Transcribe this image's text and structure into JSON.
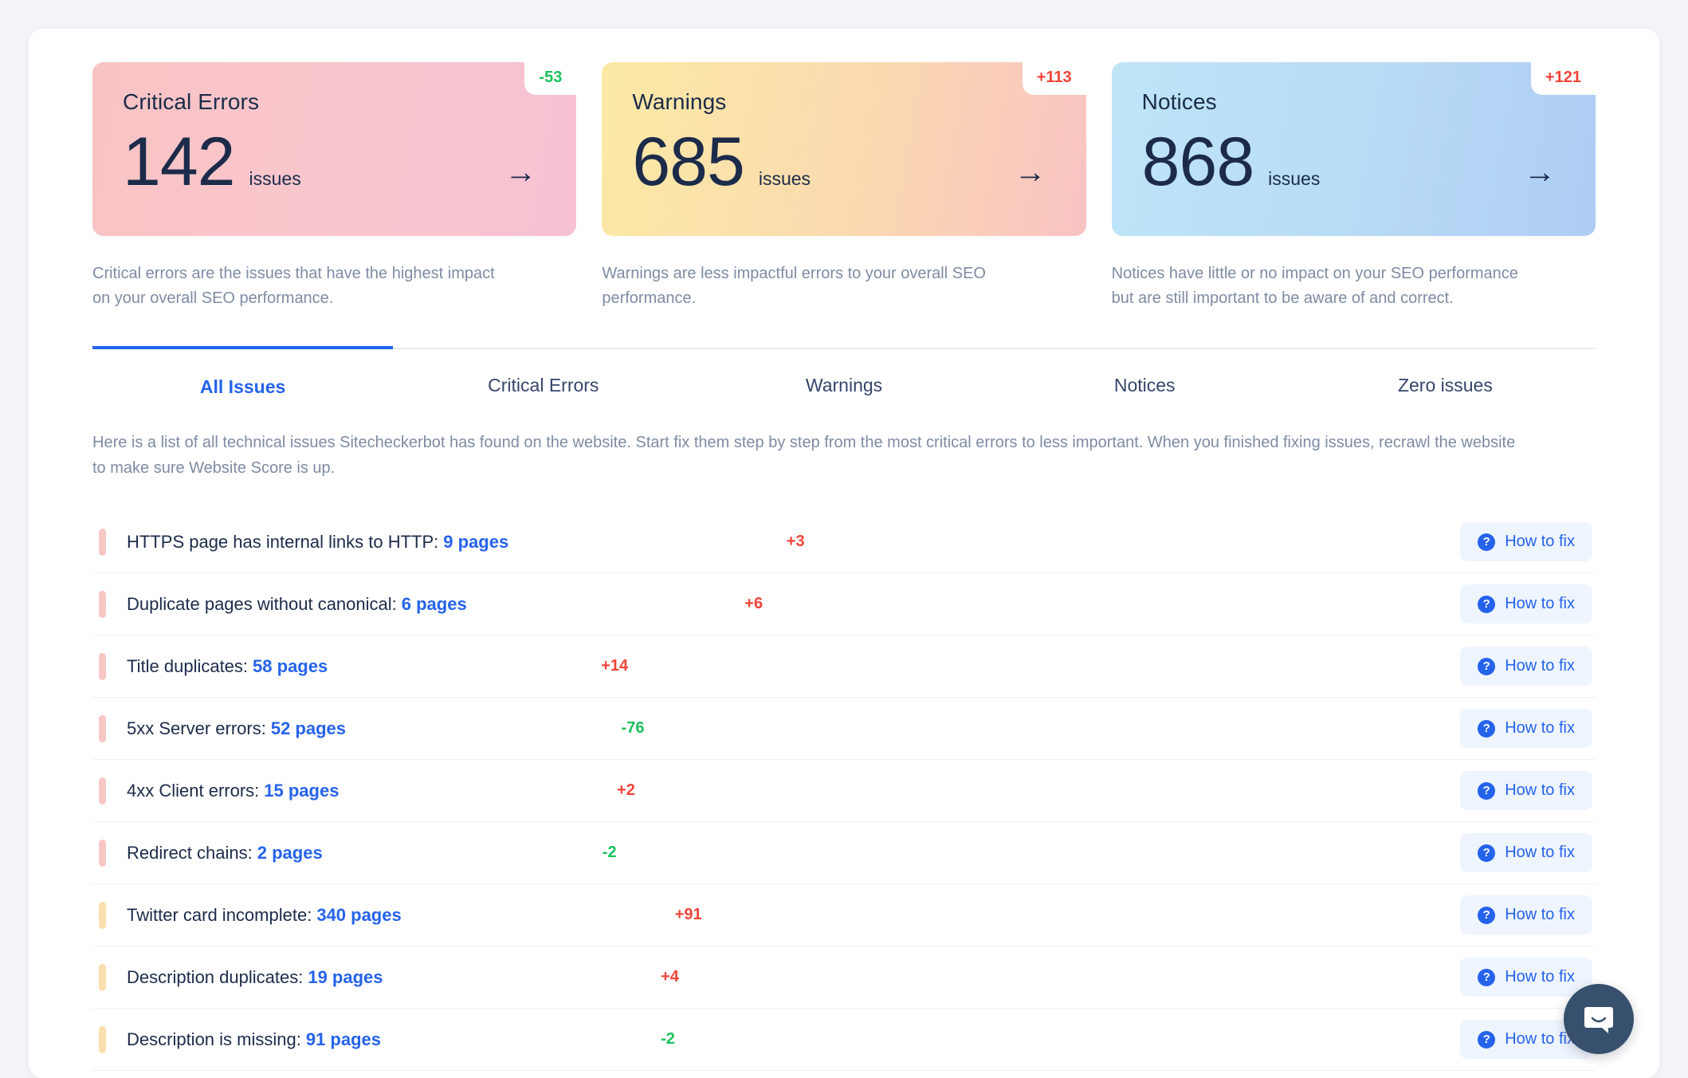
{
  "cards": [
    {
      "title": "Critical Errors",
      "value": "142",
      "unit": "issues",
      "badge": "-53",
      "badge_dir": "down",
      "arrow": "→",
      "description": "Critical errors are the issues that have the highest impact on your overall SEO performance.",
      "accent": "#f9c6c6"
    },
    {
      "title": "Warnings",
      "value": "685",
      "unit": "issues",
      "badge": "+113",
      "badge_dir": "up",
      "arrow": "→",
      "description": "Warnings are less impactful errors to your overall SEO performance.",
      "accent": "#fadfae"
    },
    {
      "title": "Notices",
      "value": "868",
      "unit": "issues",
      "badge": "+121",
      "badge_dir": "up",
      "arrow": "→",
      "description": "Notices have little or no impact on your SEO performance but are still important to be aware of and correct.",
      "accent": "#bfe0f7"
    }
  ],
  "tabs": [
    {
      "label": "All Issues",
      "active": true
    },
    {
      "label": "Critical Errors",
      "active": false
    },
    {
      "label": "Warnings",
      "active": false
    },
    {
      "label": "Notices",
      "active": false
    },
    {
      "label": "Zero issues",
      "active": false
    }
  ],
  "intro": "Here is a list of all technical issues Sitecheckerbot has found on the website. Start fix them step by step from the most critical errors to less important. When you finished fixing issues, recrawl the website to make sure Website Score is up.",
  "fix_button_label": "How to fix",
  "question_glyph": "?",
  "issues": [
    {
      "name": "HTTPS page has internal links to HTTP:",
      "count": "9 pages",
      "change": "+3",
      "dir": "up",
      "severity": "critical"
    },
    {
      "name": "Duplicate pages without canonical:",
      "count": "6 pages",
      "change": "+6",
      "dir": "up",
      "severity": "critical"
    },
    {
      "name": "Title duplicates:",
      "count": "58 pages",
      "change": "+14",
      "dir": "up",
      "severity": "critical"
    },
    {
      "name": "5xx Server errors:",
      "count": "52 pages",
      "change": "-76",
      "dir": "down",
      "severity": "critical"
    },
    {
      "name": "4xx Client errors:",
      "count": "15 pages",
      "change": "+2",
      "dir": "up",
      "severity": "critical"
    },
    {
      "name": "Redirect chains:",
      "count": "2 pages",
      "change": "-2",
      "dir": "down",
      "severity": "critical"
    },
    {
      "name": "Twitter card incomplete:",
      "count": "340 pages",
      "change": "+91",
      "dir": "up",
      "severity": "warning"
    },
    {
      "name": "Description duplicates:",
      "count": "19 pages",
      "change": "+4",
      "dir": "up",
      "severity": "warning"
    },
    {
      "name": "Description is missing:",
      "count": "91 pages",
      "change": "-2",
      "dir": "down",
      "severity": "warning"
    }
  ],
  "colors": {
    "link_blue": "#2563eb",
    "change_up": "#f04438",
    "change_down": "#18c25c",
    "text_dark": "#1c2b4a",
    "text_muted": "#7e8ba3",
    "chat_bubble": "#37506e"
  }
}
